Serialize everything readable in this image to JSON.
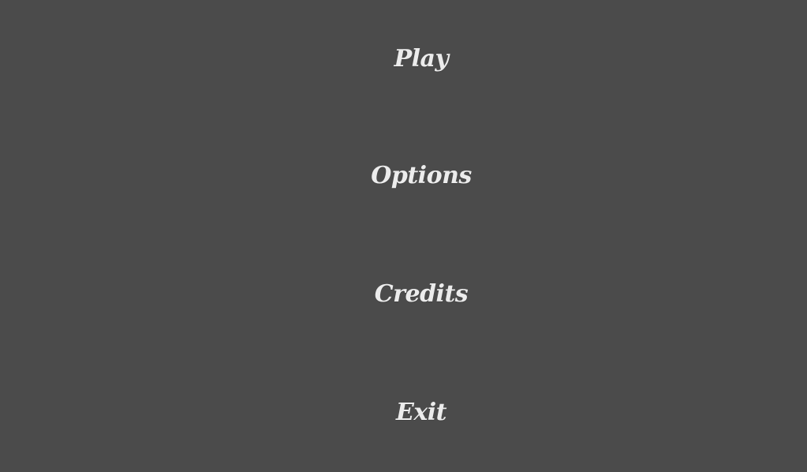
{
  "main_menu": {
    "items": [
      {
        "label": "Play"
      },
      {
        "label": "Options"
      },
      {
        "label": "Credits"
      },
      {
        "label": "Exit"
      }
    ]
  },
  "colors": {
    "background": "#4b4b4b",
    "text": "#ececec"
  }
}
